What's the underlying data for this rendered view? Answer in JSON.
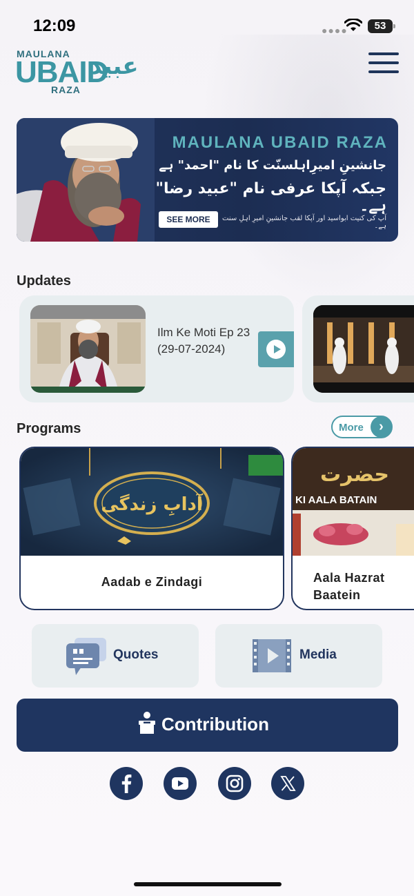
{
  "status_bar": {
    "time": "12:09",
    "battery": "53",
    "icons": [
      "signal-dots-icon",
      "wifi-icon",
      "battery-icon"
    ]
  },
  "header": {
    "logo_small_top": "MAULANA",
    "logo_big": "UBAID",
    "logo_bottom": "RAZA",
    "logo_urdu": "عبید",
    "menu_icon": "hamburger-menu-icon"
  },
  "banner": {
    "title": "MAULANA UBAID RAZA",
    "line1": "جانشینِ امیرِاہلسنّت کا نام \"احمد\" ہے",
    "line2": "جبکہ آپکا عرفی نام \"عبید رضا\" ہے۔",
    "line3": "آپ کی کنیت ابواسید اور آپکا لقب جانشینِ امیرِ اہلِ سنت ہے۔",
    "see_more_label": "SEE MORE"
  },
  "updates": {
    "title": "Updates",
    "items": [
      {
        "text": "Ilm Ke Moti Ep 23 (29-07-2024)",
        "action_icon": "play-icon"
      }
    ]
  },
  "programs": {
    "title": "Programs",
    "more_label": "More",
    "items": [
      {
        "label": "Aadab e Zindagi",
        "image_text": "آدابِ زندگی"
      },
      {
        "label": "Aala Hazrat Baatein",
        "image_text": "KI AALA BATAIN",
        "image_urdu": "حضرت"
      }
    ]
  },
  "tiles": {
    "quotes_label": "Quotes",
    "media_label": "Media"
  },
  "contribution": {
    "label": "Contribution"
  },
  "social": [
    "facebook-icon",
    "youtube-icon",
    "instagram-icon",
    "x-icon"
  ],
  "colors": {
    "navy": "#1f3560",
    "teal": "#3c96a3",
    "card_bg": "#e8eef0"
  }
}
